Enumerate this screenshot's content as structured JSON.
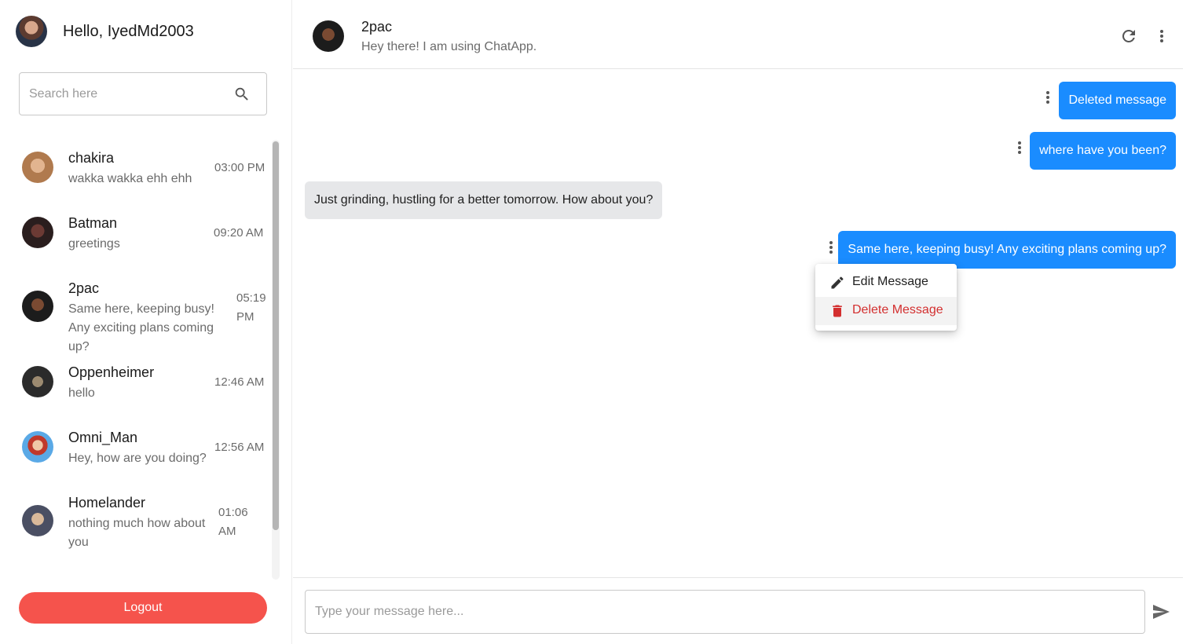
{
  "sidebar": {
    "greeting": "Hello, IyedMd2003",
    "search": {
      "placeholder": "Search here",
      "value": ""
    },
    "chats": [
      {
        "name": "chakira",
        "preview": "wakka wakka ehh ehh",
        "time": "03:00 PM"
      },
      {
        "name": "Batman",
        "preview": "greetings",
        "time": "09:20 AM"
      },
      {
        "name": "2pac",
        "preview": "Same here, keeping busy! Any exciting plans coming up?",
        "time": "05:19 PM"
      },
      {
        "name": "Oppenheimer",
        "preview": "hello",
        "time": "12:46 AM"
      },
      {
        "name": "Omni_Man",
        "preview": "Hey, how are you doing?",
        "time": "12:56 AM"
      },
      {
        "name": "Homelander",
        "preview": "nothing much how about you",
        "time": "01:06 AM"
      }
    ],
    "logout_label": "Logout"
  },
  "header": {
    "contact_name": "2pac",
    "contact_status": "Hey there! I am using ChatApp."
  },
  "messages": [
    {
      "direction": "out",
      "text": "Deleted message"
    },
    {
      "direction": "out",
      "text": "where have you been?"
    },
    {
      "direction": "in",
      "text": "Just grinding, hustling for a better tomorrow. How about you?"
    },
    {
      "direction": "out",
      "text": "Same here, keeping busy! Any exciting plans coming up?"
    }
  ],
  "context_menu": {
    "edit_label": "Edit Message",
    "delete_label": "Delete Message"
  },
  "composer": {
    "placeholder": "Type your message here...",
    "value": ""
  },
  "colors": {
    "accent": "#1a8cff",
    "logout": "#f5534c",
    "delete": "#d32f2f",
    "incoming_bubble": "#e6e7e9"
  },
  "icons": [
    "search-icon",
    "refresh-icon",
    "more-vert-icon",
    "edit-pencil-icon",
    "trash-icon",
    "send-icon"
  ]
}
